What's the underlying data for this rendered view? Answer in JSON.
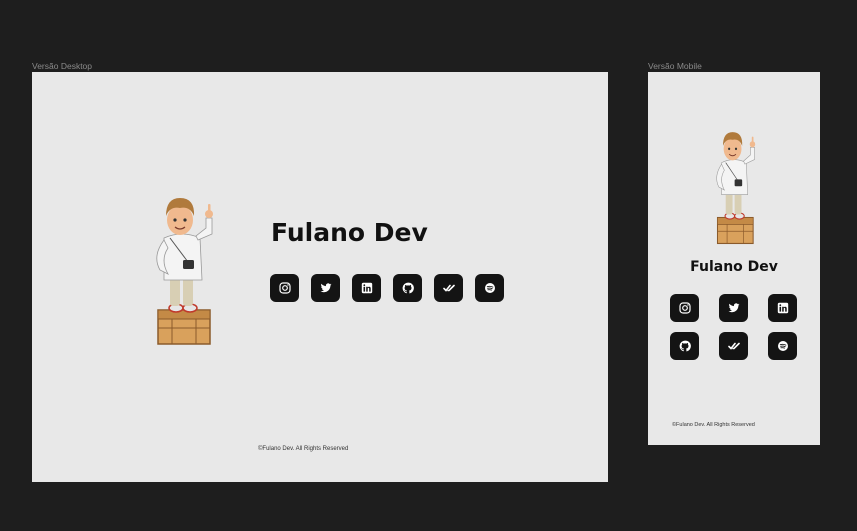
{
  "frames": {
    "desktop_label": "Versão Desktop",
    "mobile_label": "Versão Mobile"
  },
  "profile": {
    "name": "Fulano Dev",
    "footer": "©Fulano Dev. All Rights Reserved"
  },
  "social_icons": [
    "instagram-icon",
    "twitter-icon",
    "linkedin-icon",
    "github-icon",
    "checkmark-icon",
    "spotify-icon"
  ],
  "colors": {
    "canvas": "#1e1e1e",
    "frame": "#e8e8e8",
    "button": "#141414",
    "text": "#111111"
  }
}
